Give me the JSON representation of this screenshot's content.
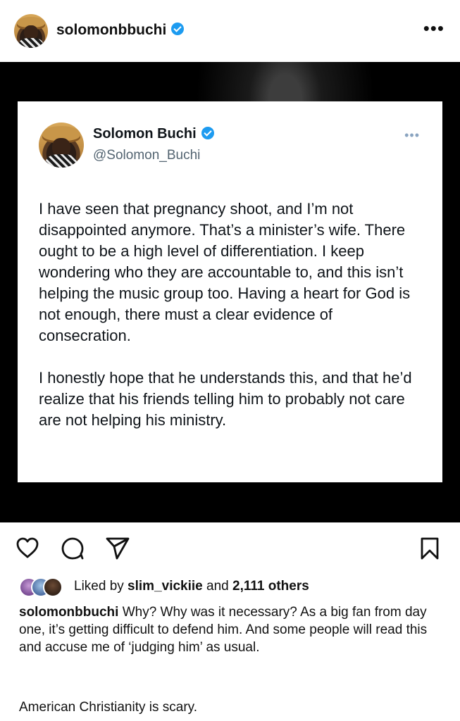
{
  "post": {
    "username": "solomonbbuchi",
    "more_label": "•••"
  },
  "tweet": {
    "name": "Solomon Buchi",
    "handle": "@Solomon_Buchi",
    "more_label": "•••",
    "paragraphs": [
      "I have seen that pregnancy shoot, and I’m not disappointed anymore. That’s a minister’s wife. There ought to be a high level of differentiation. I keep wondering who they are accountable to, and this isn’t helping the music group too. Having a heart for God is not enough, there must a clear evidence of consecration.",
      "I honestly hope that he understands this, and that he’d realize that his friends telling him to probably not care are not helping his ministry."
    ]
  },
  "actions": {
    "icons": [
      "heart-icon",
      "comment-icon",
      "share-icon",
      "bookmark-icon"
    ]
  },
  "likes": {
    "prefix": "Liked by ",
    "user": "slim_vickiie",
    "middle": " and ",
    "count": "2,111 others"
  },
  "caption": {
    "username": "solomonbbuchi",
    "text": " Why? Why was it necessary? As a big fan from day one, it’s getting difficult to defend him. And some people will read this and accuse me of ‘judging him’ as usual.",
    "extra": "American Christianity is scary."
  },
  "colors": {
    "verified": "#1d9bf0",
    "handle_gray": "#536471",
    "photo_bg": "#000000"
  }
}
